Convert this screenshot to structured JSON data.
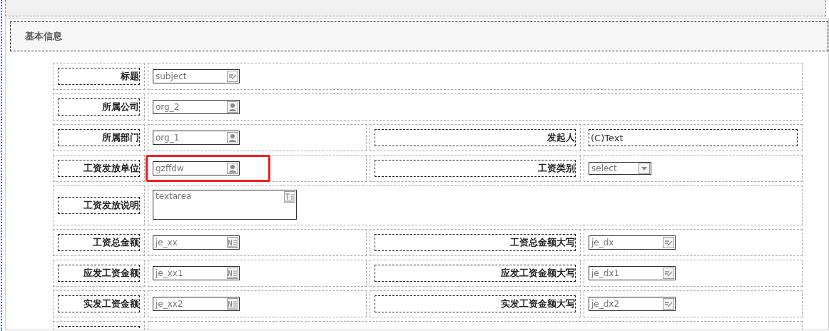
{
  "section": {
    "title": "基本信息"
  },
  "rows": [
    {
      "kind": "full",
      "cells": [
        {
          "label": "标题",
          "field": {
            "kind": "edit",
            "value": "subject"
          }
        }
      ]
    },
    {
      "kind": "full",
      "cells": [
        {
          "label": "所属公司",
          "field": {
            "kind": "person",
            "value": "org_2"
          }
        }
      ]
    },
    {
      "kind": "pair",
      "cells": [
        {
          "label": "所属部门",
          "field": {
            "kind": "person",
            "value": "org_1"
          }
        },
        {
          "label": "发起人",
          "field": {
            "kind": "plain",
            "value": "(C)Text"
          }
        }
      ]
    },
    {
      "kind": "pair",
      "cells": [
        {
          "label": "工资发放单位",
          "field": {
            "kind": "person",
            "value": "gzffdw",
            "highlighted": true
          }
        },
        {
          "label": "工资类别",
          "field": {
            "kind": "select",
            "value": "select"
          }
        }
      ]
    },
    {
      "kind": "full",
      "cells": [
        {
          "label": "工资发放说明",
          "field": {
            "kind": "textarea",
            "value": "textarea"
          }
        }
      ]
    },
    {
      "kind": "pair",
      "cells": [
        {
          "label": "工资总金额",
          "field": {
            "kind": "number",
            "value": "je_xx"
          }
        },
        {
          "label": "工资总金额大写",
          "field": {
            "kind": "edit",
            "value": "je_dx"
          }
        }
      ]
    },
    {
      "kind": "pair",
      "cells": [
        {
          "label": "应发工资金额",
          "field": {
            "kind": "number",
            "value": "je_xx1"
          }
        },
        {
          "label": "应发工资金额大写",
          "field": {
            "kind": "edit",
            "value": "je_dx1"
          }
        }
      ]
    },
    {
      "kind": "pair",
      "cells": [
        {
          "label": "实发工资金额",
          "field": {
            "kind": "number",
            "value": "je_xx2"
          }
        },
        {
          "label": "实发工资金额大写",
          "field": {
            "kind": "edit",
            "value": "je_dx2"
          }
        }
      ]
    },
    {
      "kind": "cut"
    }
  ]
}
